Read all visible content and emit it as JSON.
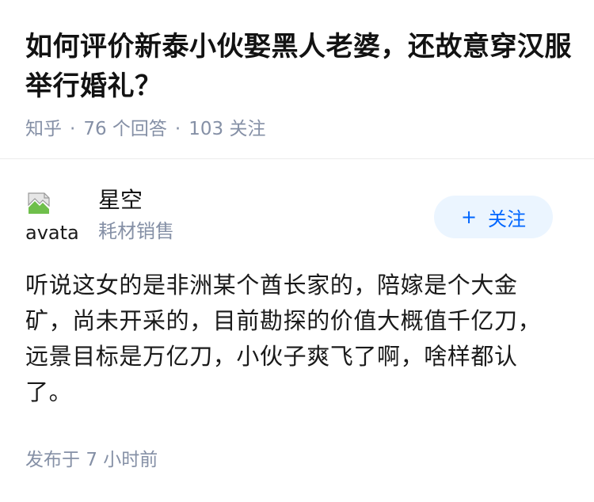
{
  "question": {
    "title": "如何评价新泰小伙娶黑人老婆，还故意穿汉服举行婚礼？",
    "source": "知乎",
    "answers_count": "76",
    "answers_label": "个回答",
    "followers_count": "103",
    "followers_label": "关注"
  },
  "author": {
    "avatar_alt": "avatar",
    "avatar_icon": "broken-image-icon",
    "name": "星空",
    "bio": "耗材销售",
    "follow_label": "关注",
    "follow_icon": "+"
  },
  "answer": {
    "text": "听说这女的是非洲某个酋长家的，陪嫁是个大金矿，尚未开采的，目前勘探的价值大概值千亿刀，远景目标是万亿刀，小伙子爽飞了啊，啥样都认了。",
    "published_label": "发布于",
    "published_time": "7 小时前"
  },
  "colors": {
    "primary_text": "#121212",
    "secondary_text": "#8590a6",
    "accent": "#0066ff",
    "follow_bg": "#ebf5ff",
    "divider": "#ececec"
  }
}
